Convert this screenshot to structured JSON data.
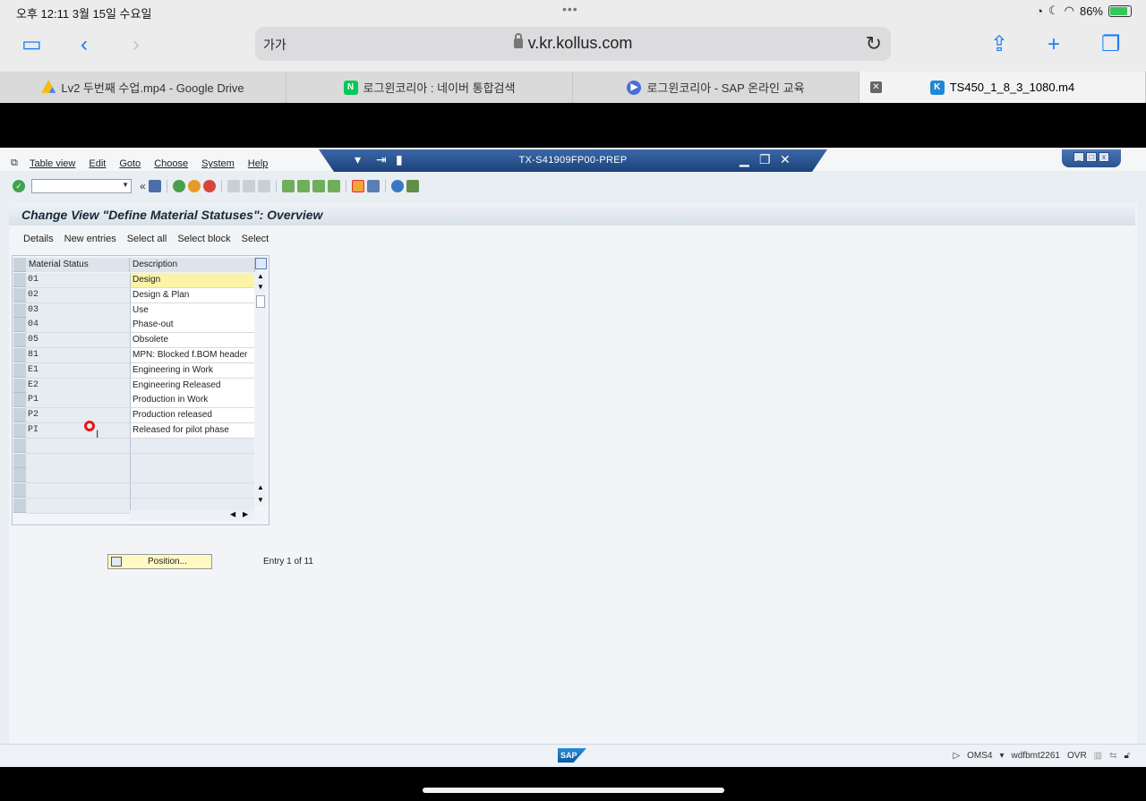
{
  "status_bar": {
    "time_date": "오후 12:11   3월 15일 수요일",
    "dots": "•••",
    "battery": "86%",
    "battery_level": 0.86
  },
  "browser": {
    "text_size_label": "가가",
    "url": "v.kr.kollus.com",
    "tabs": [
      {
        "title": "Lv2 두번째 수업.mp4 - Google Drive",
        "icon": "google-drive-icon"
      },
      {
        "title": "로그윈코리아 : 네이버 통합검색",
        "icon": "naver-icon"
      },
      {
        "title": "로그윈코리아 - SAP 온라인 교육",
        "icon": "play-icon"
      },
      {
        "title": "TS450_1_8_3_1080.m4",
        "icon": "kollus-icon",
        "active": true
      }
    ]
  },
  "sap": {
    "menu": [
      "Table view",
      "Edit",
      "Goto",
      "Choose",
      "System",
      "Help"
    ],
    "window_title": "TX-S41909FP00-PREP",
    "view_title": "Change View \"Define Material Statuses\": Overview",
    "app_toolbar": [
      "Details",
      "New entries",
      "Select all",
      "Select block",
      "Select"
    ],
    "table": {
      "columns": [
        "Material Status",
        "Description"
      ],
      "rows": [
        {
          "status": "01",
          "description": "Design"
        },
        {
          "status": "02",
          "description": "Design & Plan"
        },
        {
          "status": "03",
          "description": "Use"
        },
        {
          "status": "04",
          "description": "Phase-out"
        },
        {
          "status": "05",
          "description": "Obsolete"
        },
        {
          "status": "81",
          "description": "MPN: Blocked f.BOM header"
        },
        {
          "status": "E1",
          "description": "Engineering in Work"
        },
        {
          "status": "E2",
          "description": "Engineering Released"
        },
        {
          "status": "P1",
          "description": "Production in Work"
        },
        {
          "status": "P2",
          "description": "Production released"
        },
        {
          "status": "PI",
          "description": "Released for pilot phase"
        }
      ]
    },
    "position_button": "Position...",
    "entry_info": "Entry 1 of 11",
    "status": {
      "transaction": "OMS4",
      "server": "wdfbmt2261",
      "mode": "OVR"
    }
  },
  "colors": {
    "accent": "#1a7cf5",
    "sap_title_blue": "#1c427a",
    "focus_yellow": "#fbf4a8"
  }
}
